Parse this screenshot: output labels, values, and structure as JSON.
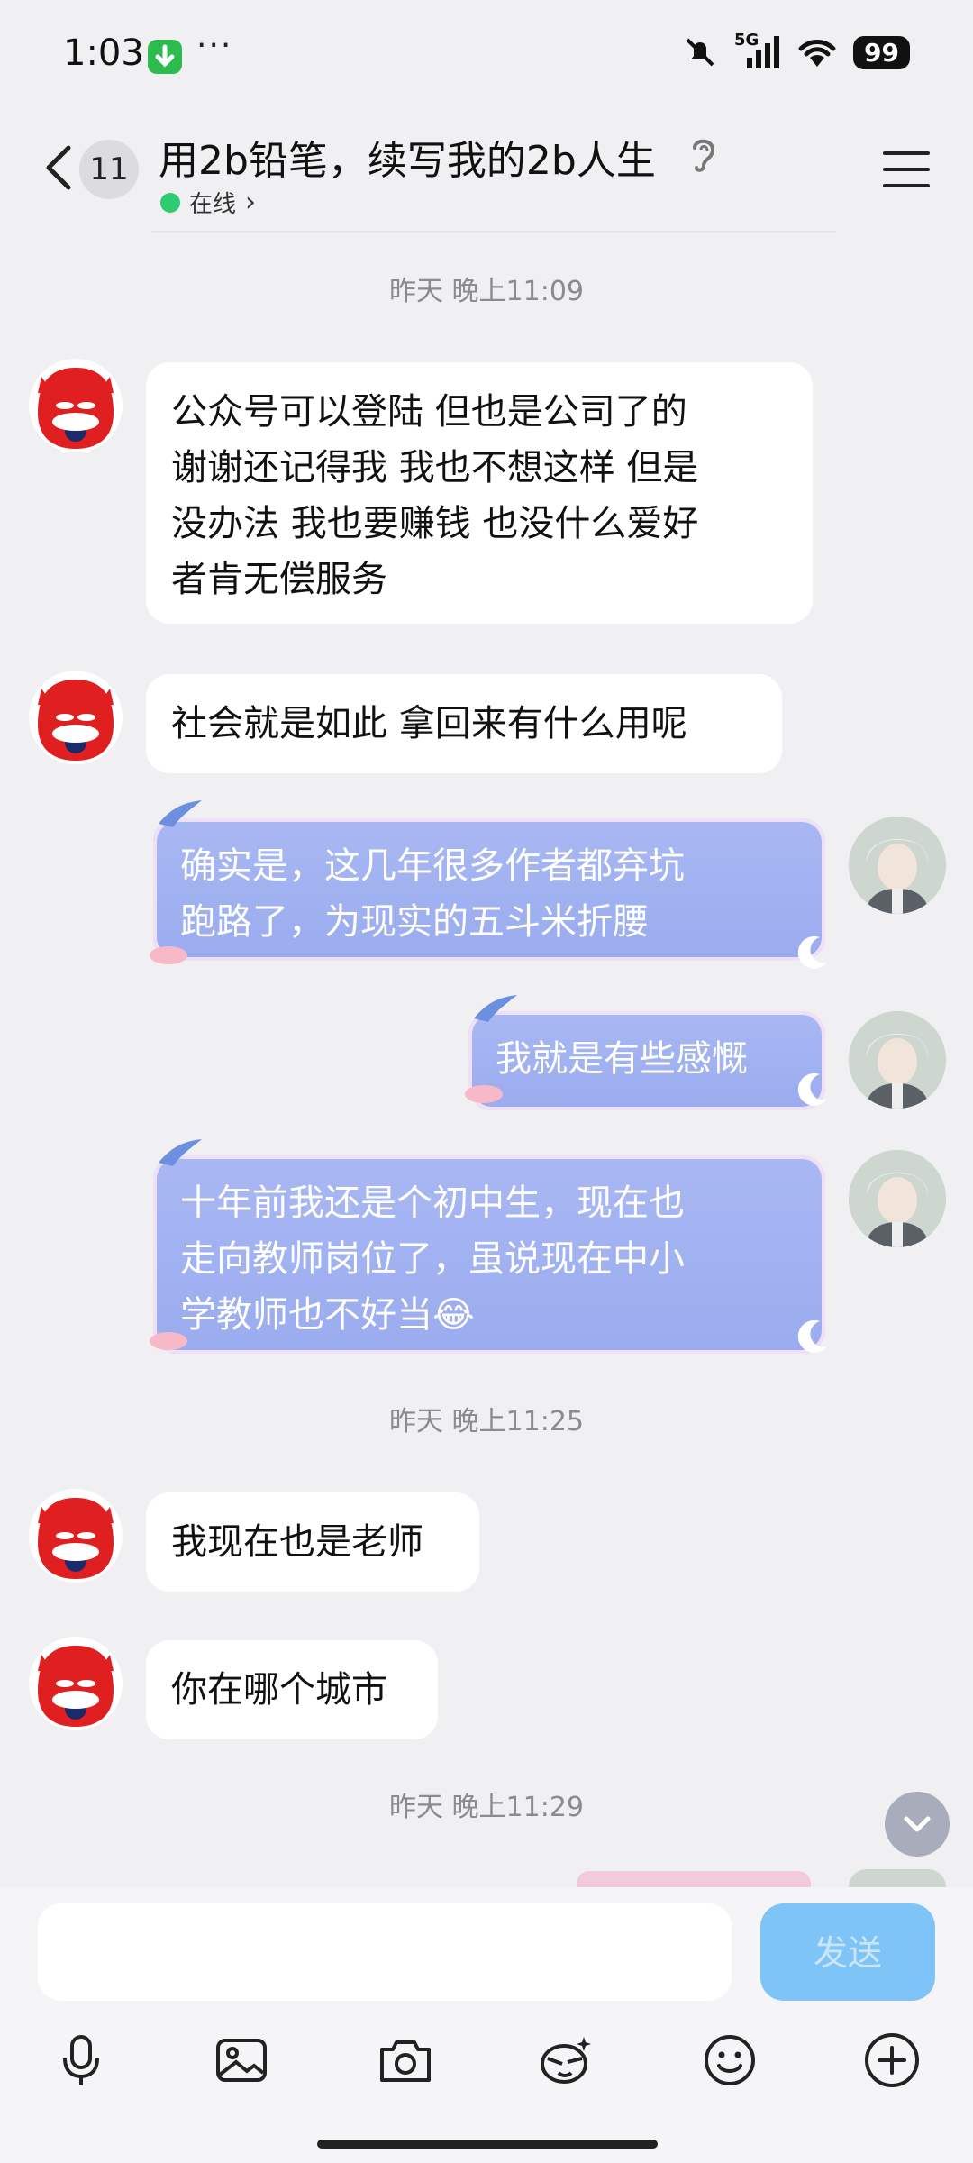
{
  "status_bar": {
    "time": "1:03",
    "more": "···",
    "network": "5G",
    "battery": "99"
  },
  "header": {
    "back_label": "",
    "unread_count": "11",
    "title": "用2b铅笔，续写我的2b人生",
    "presence": "在线",
    "presence_chevron": "›"
  },
  "messages": [
    {
      "type": "timestamp",
      "text": "昨天 晚上11:09"
    },
    {
      "type": "received",
      "lines": [
        "公众号可以登陆 但也是公司了的",
        "谢谢还记得我 我也不想这样 但是",
        "没办法 我也要赚钱 也没什么爱好",
        "者肯无偿服务"
      ]
    },
    {
      "type": "received",
      "lines": [
        "社会就是如此 拿回来有什么用呢"
      ]
    },
    {
      "type": "sent",
      "lines": [
        "确实是，这几年很多作者都弃坑",
        "跑路了，为现实的五斗米折腰"
      ]
    },
    {
      "type": "sent",
      "lines": [
        "我就是有些感慨"
      ]
    },
    {
      "type": "sent",
      "lines": [
        "十年前我还是个初中生，现在也",
        "走向教师岗位了，虽说现在中小",
        "学教师也不好当😂"
      ]
    },
    {
      "type": "timestamp",
      "text": "昨天 晚上11:25"
    },
    {
      "type": "received",
      "lines": [
        "我现在也是老师"
      ]
    },
    {
      "type": "received",
      "lines": [
        "你在哪个城市"
      ]
    },
    {
      "type": "timestamp",
      "text": "昨天 晚上11:29"
    }
  ],
  "composer": {
    "input_value": "",
    "send_label": "发送"
  },
  "icons": [
    "back-icon",
    "ear-icon",
    "menu-icon",
    "chevron-down-icon",
    "microphone-icon",
    "image-icon",
    "camera-icon",
    "sticker-icon",
    "emoji-icon",
    "plus-icon"
  ],
  "colors": {
    "sent_bubble": "#9aacef",
    "received_bubble": "#ffffff",
    "send_button": "#7ec4f7",
    "online_dot": "#2ecc71"
  }
}
